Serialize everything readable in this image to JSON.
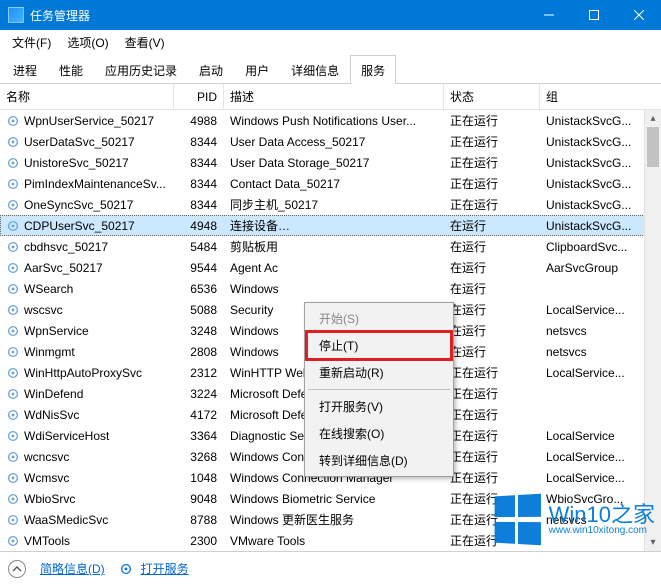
{
  "window": {
    "title": "任务管理器"
  },
  "window_controls": {
    "min": "minimize",
    "max": "maximize",
    "close": "close"
  },
  "menu": {
    "file": "文件(F)",
    "options": "选项(O)",
    "view": "查看(V)"
  },
  "tabs": {
    "processes": "进程",
    "performance": "性能",
    "app_history": "应用历史记录",
    "startup": "启动",
    "users": "用户",
    "details": "详细信息",
    "services": "服务"
  },
  "active_tab": "services",
  "columns": {
    "name": "名称",
    "pid": "PID",
    "desc": "描述",
    "status": "状态",
    "group": "组"
  },
  "services": [
    {
      "name": "WpnUserService_50217",
      "pid": "4988",
      "desc": "Windows Push Notifications User...",
      "status": "正在运行",
      "group": "UnistackSvcG..."
    },
    {
      "name": "UserDataSvc_50217",
      "pid": "8344",
      "desc": "User Data Access_50217",
      "status": "正在运行",
      "group": "UnistackSvcG..."
    },
    {
      "name": "UnistoreSvc_50217",
      "pid": "8344",
      "desc": "User Data Storage_50217",
      "status": "正在运行",
      "group": "UnistackSvcG..."
    },
    {
      "name": "PimIndexMaintenanceSv...",
      "pid": "8344",
      "desc": "Contact Data_50217",
      "status": "正在运行",
      "group": "UnistackSvcG..."
    },
    {
      "name": "OneSyncSvc_50217",
      "pid": "8344",
      "desc": "同步主机_50217",
      "status": "正在运行",
      "group": "UnistackSvcG..."
    },
    {
      "name": "CDPUserSvc_50217",
      "pid": "4948",
      "desc": "连接设备…",
      "status": "在运行",
      "group": "UnistackSvcG...",
      "selected": true
    },
    {
      "name": "cbdhsvc_50217",
      "pid": "5484",
      "desc": "剪贴板用",
      "status": "在运行",
      "group": "ClipboardSvc..."
    },
    {
      "name": "AarSvc_50217",
      "pid": "9544",
      "desc": "Agent Ac",
      "status": "在运行",
      "group": "AarSvcGroup"
    },
    {
      "name": "WSearch",
      "pid": "6536",
      "desc": "Windows",
      "status": "在运行",
      "group": ""
    },
    {
      "name": "wscsvc",
      "pid": "5088",
      "desc": "Security",
      "status": "在运行",
      "group": "LocalService..."
    },
    {
      "name": "WpnService",
      "pid": "3248",
      "desc": "Windows",
      "status": "在运行",
      "group": "netsvcs"
    },
    {
      "name": "Winmgmt",
      "pid": "2808",
      "desc": "Windows",
      "status": "在运行",
      "group": "netsvcs"
    },
    {
      "name": "WinHttpAutoProxySvc",
      "pid": "2312",
      "desc": "WinHTTP Web Proxy Auto-Discov...",
      "status": "正在运行",
      "group": "LocalService..."
    },
    {
      "name": "WinDefend",
      "pid": "3224",
      "desc": "Microsoft Defender Antivirus Ser...",
      "status": "正在运行",
      "group": ""
    },
    {
      "name": "WdNisSvc",
      "pid": "4172",
      "desc": "Microsoft Defender Antivirus Net...",
      "status": "正在运行",
      "group": ""
    },
    {
      "name": "WdiServiceHost",
      "pid": "3364",
      "desc": "Diagnostic Service Host",
      "status": "正在运行",
      "group": "LocalService"
    },
    {
      "name": "wcncsvc",
      "pid": "3268",
      "desc": "Windows Connect Now - Config ...",
      "status": "正在运行",
      "group": "LocalService..."
    },
    {
      "name": "Wcmsvc",
      "pid": "1048",
      "desc": "Windows Connection Manager",
      "status": "正在运行",
      "group": "LocalService..."
    },
    {
      "name": "WbioSrvc",
      "pid": "9048",
      "desc": "Windows Biometric Service",
      "status": "正在运行",
      "group": "WbioSvcGro..."
    },
    {
      "name": "WaaSMedicSvc",
      "pid": "8788",
      "desc": "Windows 更新医生服务",
      "status": "正在运行",
      "group": "netsvcs"
    },
    {
      "name": "VMTools",
      "pid": "2300",
      "desc": "VMware Tools",
      "status": "正在运行",
      "group": ""
    }
  ],
  "context_menu": {
    "start": "开始(S)",
    "stop": "停止(T)",
    "restart": "重新启动(R)",
    "open_services": "打开服务(V)",
    "search_online": "在线搜索(O)",
    "goto_details": "转到详细信息(D)"
  },
  "footer": {
    "fewer_details": "简略信息(D)",
    "open_services": "打开服务"
  },
  "watermark": {
    "brand": "Win10之家",
    "url": "www.win10xitong.com"
  }
}
